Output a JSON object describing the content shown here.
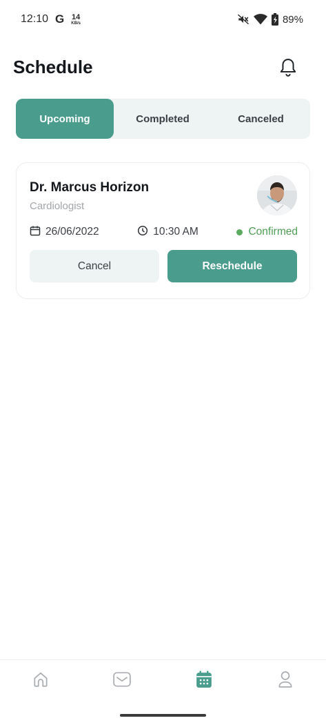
{
  "status_bar": {
    "time": "12:10",
    "g_label": "G",
    "net_speed": "14",
    "net_unit": "KB/s",
    "battery": "89%"
  },
  "header": {
    "title": "Schedule",
    "bell_icon": "bell-icon"
  },
  "tabs": [
    {
      "label": "Upcoming",
      "active": true
    },
    {
      "label": "Completed",
      "active": false
    },
    {
      "label": "Canceled",
      "active": false
    }
  ],
  "appointment": {
    "doctor_name": "Dr. Marcus Horizon",
    "specialty": "Cardiologist",
    "date": "26/06/2022",
    "time": "10:30 AM",
    "status": "Confirmed",
    "cancel_label": "Cancel",
    "reschedule_label": "Reschedule"
  },
  "bottom_nav": [
    {
      "icon": "home-icon",
      "active": false
    },
    {
      "icon": "message-icon",
      "active": false
    },
    {
      "icon": "calendar-icon",
      "active": true
    },
    {
      "icon": "profile-icon",
      "active": false
    }
  ],
  "colors": {
    "accent": "#4a9c8d",
    "tab_background": "#eef3f3",
    "status_confirmed": "#4f9d56",
    "inactive_icon": "#a9adb1"
  }
}
